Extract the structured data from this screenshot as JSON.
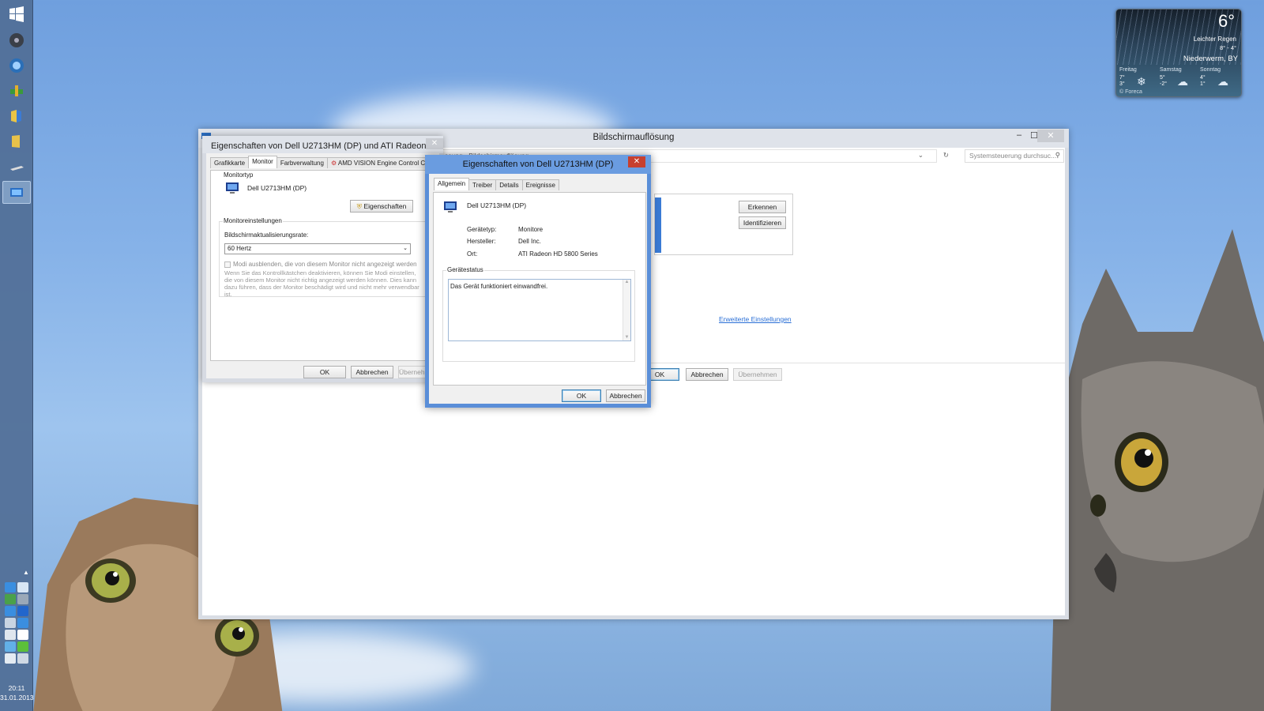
{
  "taskbar": {
    "clock_time": "20:11",
    "clock_date": "31.01.2013"
  },
  "weather": {
    "temperature": "6°",
    "condition": "Leichter Regen",
    "high_low": "8° - 4°",
    "location": "Niederwerm, BY",
    "days": [
      {
        "name": "Freitag",
        "high": "7°",
        "low": "3°"
      },
      {
        "name": "Samstag",
        "high": "5°",
        "low": "-2°"
      },
      {
        "name": "Sonntag",
        "high": "4°",
        "low": "1°"
      }
    ],
    "brand": "© Foreca"
  },
  "main_window": {
    "title": "Bildschirmauflösung",
    "breadcrumb": "ssung  ›  Bildschirmauflösung",
    "search_placeholder": "Systemsteuerung durchsuc...",
    "detect_button": "Erkennen",
    "identify_button": "Identifizieren",
    "advanced_link": "Erweiterte Einstellungen",
    "ok_button": "OK",
    "cancel_button": "Abbrechen",
    "apply_button": "Übernehmen"
  },
  "props_dialog": {
    "title": "Eigenschaften von Dell U2713HM (DP) und ATI Radeon ...",
    "tabs": [
      "Grafikkarte",
      "Monitor",
      "Farbverwaltung",
      "AMD VISION Engine Control Cen"
    ],
    "active_tab": "Monitor",
    "monitor_type_caption": "Monitortyp",
    "monitor_name": "Dell U2713HM (DP)",
    "properties_button": "Eigenschaften",
    "settings_caption": "Monitoreinstellungen",
    "refresh_label": "Bildschirmaktualisierungsrate:",
    "refresh_value": "60 Hertz",
    "hide_modes_label": "Modi ausblenden, die von diesem Monitor nicht angezeigt werden",
    "hide_modes_note": "Wenn Sie das Kontrollkästchen deaktivieren, können Sie Modi einstellen, die von diesem Monitor nicht richtig angezeigt werden können. Dies kann dazu führen, dass der Monitor beschädigt wird und nicht mehr verwendbar ist.",
    "ok_button": "OK",
    "cancel_button": "Abbrechen",
    "apply_button": "Übernehm"
  },
  "device_dialog": {
    "title": "Eigenschaften von Dell U2713HM (DP)",
    "tabs": [
      "Allgemein",
      "Treiber",
      "Details",
      "Ereignisse"
    ],
    "active_tab": "Allgemein",
    "device_name": "Dell U2713HM (DP)",
    "type_label": "Gerätetyp:",
    "type_value": "Monitore",
    "manufacturer_label": "Hersteller:",
    "manufacturer_value": "Dell Inc.",
    "location_label": "Ort:",
    "location_value": "ATI Radeon HD 5800 Series",
    "status_caption": "Gerätestatus",
    "status_text": "Das Gerät funktioniert einwandfrei.",
    "ok_button": "OK",
    "cancel_button": "Abbrechen"
  },
  "colors": {
    "sky": "#7fa9d9",
    "active_title": "#6a9ce0",
    "close_red": "#c7402f",
    "link": "#2a6fd6"
  }
}
